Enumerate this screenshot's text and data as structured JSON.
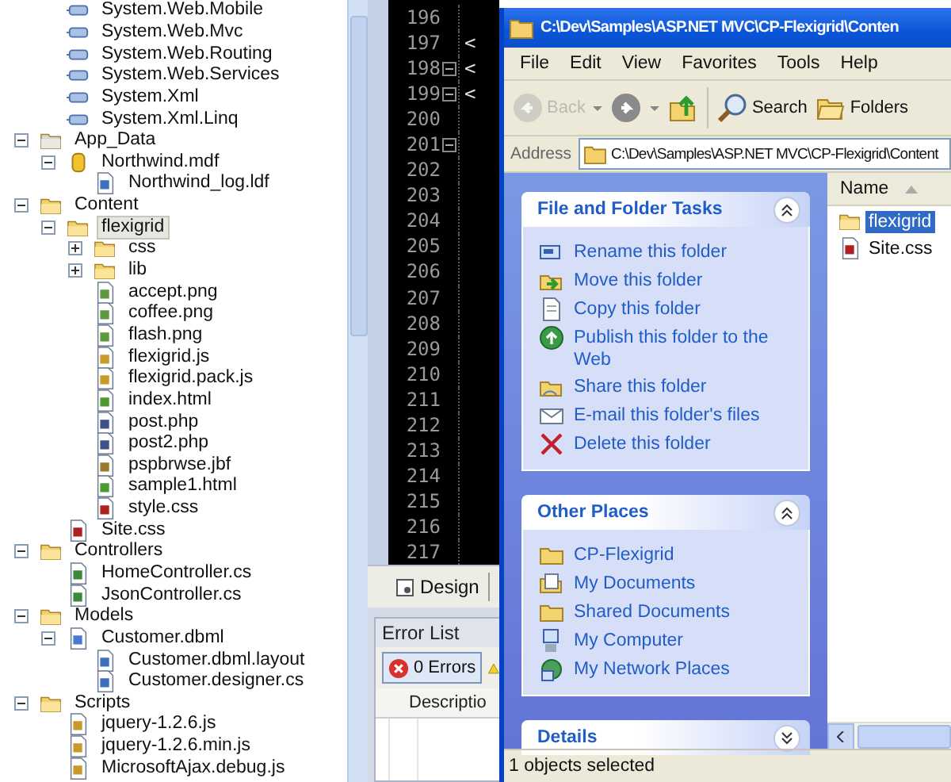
{
  "solution_explorer": {
    "continued_items": [
      {
        "label": "System.Web.Mobile",
        "kind": "reference",
        "highlighted": false
      },
      {
        "label": "System.Web.Mvc",
        "kind": "reference",
        "highlighted": false
      },
      {
        "label": "System.Web.Routing",
        "kind": "reference",
        "highlighted": false
      },
      {
        "label": "System.Web.Services",
        "kind": "reference",
        "highlighted": false
      },
      {
        "label": "System.Xml",
        "kind": "reference",
        "highlighted": false
      },
      {
        "label": "System.Xml.Linq",
        "kind": "reference",
        "highlighted": false
      }
    ],
    "items": [
      {
        "label": "App_Data",
        "kind": "special-folder",
        "expanded": true,
        "highlighted": false,
        "children": [
          {
            "label": "Northwind.mdf",
            "kind": "database",
            "expanded": true,
            "highlighted": false,
            "children": [
              {
                "label": "Northwind_log.ldf",
                "kind": "linked-file",
                "highlighted": false
              }
            ]
          }
        ]
      },
      {
        "label": "Content",
        "kind": "folder",
        "expanded": true,
        "highlighted": false,
        "children": [
          {
            "label": "flexigrid",
            "kind": "folder",
            "expanded": true,
            "highlighted": true,
            "children": [
              {
                "label": "css",
                "kind": "folder",
                "expanded": false,
                "highlighted": false
              },
              {
                "label": "lib",
                "kind": "folder",
                "expanded": false,
                "highlighted": false
              },
              {
                "label": "accept.png",
                "kind": "image",
                "highlighted": false
              },
              {
                "label": "coffee.png",
                "kind": "image",
                "highlighted": false
              },
              {
                "label": "flash.png",
                "kind": "image",
                "highlighted": false
              },
              {
                "label": "flexigrid.js",
                "kind": "script",
                "highlighted": false
              },
              {
                "label": "flexigrid.pack.js",
                "kind": "script",
                "highlighted": false
              },
              {
                "label": "index.html",
                "kind": "html",
                "highlighted": false
              },
              {
                "label": "post.php",
                "kind": "php",
                "highlighted": false
              },
              {
                "label": "post2.php",
                "kind": "php",
                "highlighted": false
              },
              {
                "label": "pspbrwse.jbf",
                "kind": "jbf",
                "highlighted": false
              },
              {
                "label": "sample1.html",
                "kind": "html",
                "highlighted": false
              },
              {
                "label": "style.css",
                "kind": "css",
                "highlighted": false
              }
            ]
          },
          {
            "label": "Site.css",
            "kind": "css",
            "highlighted": false
          }
        ]
      },
      {
        "label": "Controllers",
        "kind": "folder",
        "expanded": true,
        "highlighted": false,
        "children": [
          {
            "label": "HomeController.cs",
            "kind": "cs",
            "highlighted": false
          },
          {
            "label": "JsonController.cs",
            "kind": "cs",
            "highlighted": false
          }
        ]
      },
      {
        "label": "Models",
        "kind": "folder",
        "expanded": true,
        "highlighted": false,
        "children": [
          {
            "label": "Customer.dbml",
            "kind": "dbml",
            "expanded": true,
            "highlighted": false,
            "children": [
              {
                "label": "Customer.dbml.layout",
                "kind": "linked-file",
                "highlighted": false
              },
              {
                "label": "Customer.designer.cs",
                "kind": "linked-file",
                "highlighted": false
              }
            ]
          }
        ]
      },
      {
        "label": "Scripts",
        "kind": "folder",
        "expanded": true,
        "highlighted": false,
        "children": [
          {
            "label": "jquery-1.2.6.js",
            "kind": "script",
            "highlighted": false
          },
          {
            "label": "jquery-1.2.6.min.js",
            "kind": "script",
            "highlighted": false
          },
          {
            "label": "MicrosoftAjax.debug.js",
            "kind": "script",
            "highlighted": false
          }
        ]
      }
    ]
  },
  "editor": {
    "lines": [
      {
        "number": "196",
        "fold": false
      },
      {
        "number": "197",
        "fold": false,
        "text": "<"
      },
      {
        "number": "198",
        "fold": true,
        "text": "<"
      },
      {
        "number": "199",
        "fold": true,
        "text": "<"
      },
      {
        "number": "200",
        "fold": false
      },
      {
        "number": "201",
        "fold": true
      },
      {
        "number": "202",
        "fold": false
      },
      {
        "number": "203",
        "fold": false
      },
      {
        "number": "204",
        "fold": false
      },
      {
        "number": "205",
        "fold": false
      },
      {
        "number": "206",
        "fold": false
      },
      {
        "number": "207",
        "fold": false
      },
      {
        "number": "208",
        "fold": false
      },
      {
        "number": "209",
        "fold": false
      },
      {
        "number": "210",
        "fold": false
      },
      {
        "number": "211",
        "fold": false
      },
      {
        "number": "212",
        "fold": false
      },
      {
        "number": "213",
        "fold": false
      },
      {
        "number": "214",
        "fold": false
      },
      {
        "number": "215",
        "fold": false
      },
      {
        "number": "216",
        "fold": false
      },
      {
        "number": "217",
        "fold": false
      }
    ],
    "view_tabs": [
      {
        "label": "Design",
        "selected": false
      }
    ]
  },
  "error_list": {
    "title": "Error List",
    "buttons": [
      {
        "label": "0 Errors",
        "kind": "errors"
      }
    ],
    "columns": [
      "Descriptio"
    ]
  },
  "explorer_window": {
    "title": "C:\\Dev\\Samples\\ASP.NET MVC\\CP-Flexigrid\\Conten",
    "menu": [
      "File",
      "Edit",
      "View",
      "Favorites",
      "Tools",
      "Help"
    ],
    "toolbar": [
      {
        "label": "Back",
        "kind": "back",
        "disabled": true
      },
      {
        "kind": "forward",
        "disabled": false
      },
      {
        "kind": "up",
        "disabled": false
      },
      {
        "label": "Search",
        "kind": "search",
        "disabled": false
      },
      {
        "label": "Folders",
        "kind": "folders",
        "disabled": false
      }
    ],
    "address": {
      "label": "Address",
      "value": "C:\\Dev\\Samples\\ASP.NET MVC\\CP-Flexigrid\\Content"
    },
    "task_panels": [
      {
        "title": "File and Folder Tasks",
        "expanded": true,
        "items": [
          {
            "label": "Rename this folder",
            "kind": "rename"
          },
          {
            "label": "Move this folder",
            "kind": "move"
          },
          {
            "label": "Copy this folder",
            "kind": "copy"
          },
          {
            "label": "Publish this folder to the Web",
            "kind": "publish"
          },
          {
            "label": "Share this folder",
            "kind": "share"
          },
          {
            "label": "E-mail this folder's files",
            "kind": "email"
          },
          {
            "label": "Delete this folder",
            "kind": "delete"
          }
        ]
      },
      {
        "title": "Other Places",
        "expanded": true,
        "items": [
          {
            "label": "CP-Flexigrid",
            "kind": "folder"
          },
          {
            "label": "My Documents",
            "kind": "documents"
          },
          {
            "label": "Shared Documents",
            "kind": "folder"
          },
          {
            "label": "My Computer",
            "kind": "computer"
          },
          {
            "label": "My Network Places",
            "kind": "network"
          }
        ]
      },
      {
        "title": "Details",
        "expanded": false
      }
    ],
    "file_list": {
      "column": "Name",
      "files": [
        {
          "name": "flexigrid",
          "kind": "folder",
          "selected": true
        },
        {
          "name": "Site.css",
          "kind": "css",
          "selected": false
        }
      ]
    },
    "status": "1 objects selected"
  }
}
